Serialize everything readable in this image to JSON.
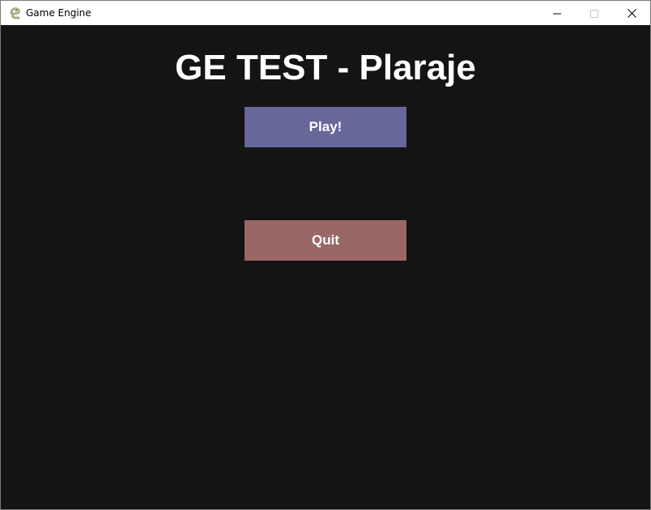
{
  "window": {
    "title": "Game Engine",
    "app_icon": "pygame-snake-icon",
    "controls": {
      "minimize_icon": "minimize-icon",
      "maximize_icon": "maximize-icon",
      "close_icon": "close-icon"
    }
  },
  "game": {
    "background_color": "#141414",
    "title": "GE TEST - Plaraje",
    "buttons": [
      {
        "label": "Play!",
        "color": "#67679a"
      },
      {
        "label": "Quit",
        "color": "#9a6767"
      }
    ]
  }
}
